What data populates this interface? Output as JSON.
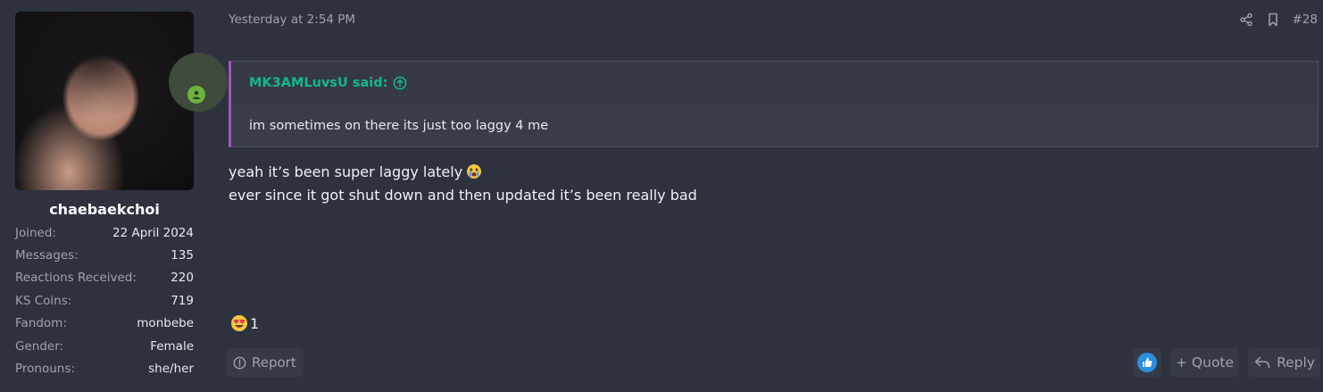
{
  "user": {
    "username": "chaebaekchoi",
    "stats": [
      {
        "label": "Joined:",
        "value": "22 April 2024"
      },
      {
        "label": "Messages:",
        "value": "135"
      },
      {
        "label": "Reactions Received:",
        "value": "220"
      },
      {
        "label": "KS Coins:",
        "value": "719"
      },
      {
        "label": "Fandom:",
        "value": "monbebe"
      },
      {
        "label": "Gender:",
        "value": "Female"
      },
      {
        "label": "Pronouns:",
        "value": "she/her"
      }
    ]
  },
  "post": {
    "date": "Yesterday at 2:54 PM",
    "number": "#28",
    "quote": {
      "author": "MK3AMLuvsU said:",
      "text": "im sometimes on there its just too laggy 4 me"
    },
    "message_lines": [
      "yeah it’s been super laggy lately",
      "ever since it got shut down and then updated it’s been really bad"
    ],
    "reaction_count": "1"
  },
  "actions": {
    "report": "Report",
    "quote": "+ Quote",
    "reply": "Reply"
  },
  "colors": {
    "background": "#2e323f",
    "quote_author": "#16b889",
    "quote_border": "#a05ab5",
    "online": "#6cb33f",
    "like": "#2b8fe0"
  },
  "icons": {
    "share": "share-icon",
    "bookmark": "bookmark-icon",
    "quote_up": "arrow-up-circle-icon",
    "crying_emoji": "crying-face-emoji",
    "heart_eyes_emoji": "heart-eyes-emoji",
    "report": "exclamation-circle-icon",
    "like": "thumbs-up-icon",
    "reply": "reply-arrow-icon"
  }
}
